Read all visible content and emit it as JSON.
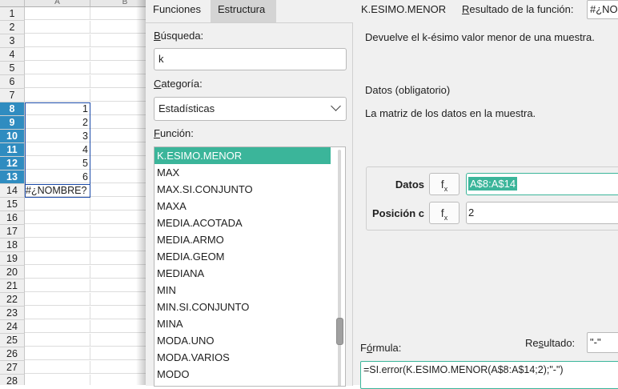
{
  "sheet": {
    "columns": [
      "A",
      "B"
    ],
    "rows": [
      {
        "num": "1",
        "a": ""
      },
      {
        "num": "2",
        "a": ""
      },
      {
        "num": "3",
        "a": ""
      },
      {
        "num": "4",
        "a": ""
      },
      {
        "num": "5",
        "a": ""
      },
      {
        "num": "6",
        "a": ""
      },
      {
        "num": "7",
        "a": ""
      },
      {
        "num": "8",
        "a": "1"
      },
      {
        "num": "9",
        "a": "2"
      },
      {
        "num": "10",
        "a": "3"
      },
      {
        "num": "11",
        "a": "4"
      },
      {
        "num": "12",
        "a": "5"
      },
      {
        "num": "13",
        "a": "6"
      },
      {
        "num": "14",
        "a": "#¿NOMBRE?"
      },
      {
        "num": "15",
        "a": ""
      },
      {
        "num": "16",
        "a": ""
      },
      {
        "num": "17",
        "a": ""
      },
      {
        "num": "18",
        "a": ""
      },
      {
        "num": "19",
        "a": ""
      },
      {
        "num": "20",
        "a": ""
      },
      {
        "num": "21",
        "a": ""
      },
      {
        "num": "22",
        "a": ""
      },
      {
        "num": "23",
        "a": ""
      },
      {
        "num": "24",
        "a": ""
      },
      {
        "num": "25",
        "a": ""
      },
      {
        "num": "26",
        "a": ""
      },
      {
        "num": "27",
        "a": ""
      },
      {
        "num": "28",
        "a": ""
      }
    ],
    "selected_rows": [
      "8",
      "9",
      "10",
      "11",
      "12",
      "13"
    ]
  },
  "dialog": {
    "tabs": {
      "functions": "Funciones",
      "structure": "Estructura"
    },
    "search_label": "Búsqueda:",
    "search_value": "k",
    "category_label": "Categoría:",
    "category_value": "Estadísticas",
    "function_label": "Función:",
    "functions": [
      "K.ESIMO.MENOR",
      "MAX",
      "MAX.SI.CONJUNTO",
      "MAXA",
      "MEDIA.ACOTADA",
      "MEDIA.ARMO",
      "MEDIA.GEOM",
      "MEDIANA",
      "MIN",
      "MIN.SI.CONJUNTO",
      "MINA",
      "MODA.UNO",
      "MODA.VARIOS",
      "MODO"
    ],
    "selected_function": "K.ESIMO.MENOR",
    "func_name": "K.ESIMO.MENOR",
    "func_result_label": "Resultado de la función:",
    "func_result_value": "#¿NOMBRE?",
    "description": "Devuelve el k-ésimo valor menor de una muestra.",
    "arg_title": "Datos (obligatorio)",
    "arg_description": "La matriz de los datos en la muestra.",
    "args": [
      {
        "label": "Datos",
        "fx": "f",
        "value": "A$8:A$14"
      },
      {
        "label": "Posición c",
        "fx": "f",
        "value": "2"
      }
    ],
    "formula_label": "Fórmula:",
    "result_label": "Resultado:",
    "result_value": "\"-\"",
    "formula_value": "=SI.error(K.ESIMO.MENOR(A$8:A$14;2);\"-\")"
  },
  "colors": {
    "accent": "#3bb59a",
    "row_selected": "#2f8cc0",
    "range_border": "#1b4aa8"
  }
}
